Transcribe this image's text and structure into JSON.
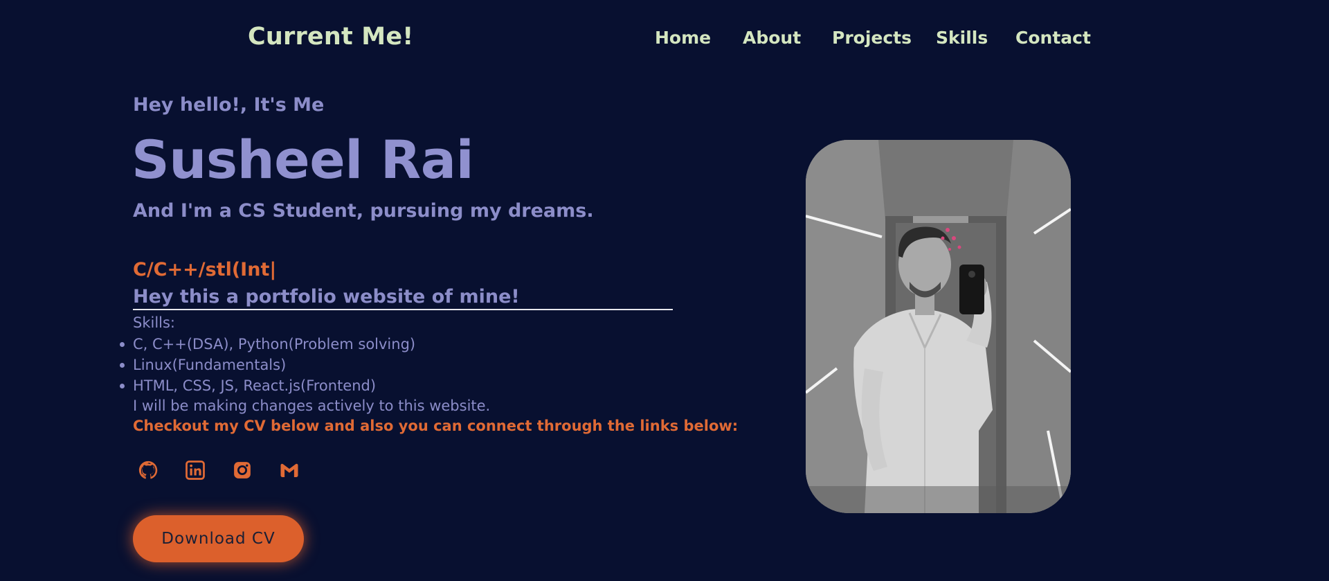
{
  "header": {
    "brand": "Current Me!",
    "nav": [
      "Home",
      "About",
      "Projects",
      "Skills",
      "Contact"
    ]
  },
  "hero": {
    "greeting": "Hey hello!, It's Me",
    "name": "Susheel Rai",
    "tagline": "And I'm a CS Student, pursuing my dreams.",
    "typed_text": "C/C++/stl(Int|",
    "portfolio_line": "Hey this a portfolio website of mine!",
    "skills_title": "Skills:",
    "skills": [
      "C, C++(DSA), Python(Problem solving)",
      "Linux(Fundamentals)",
      "HTML, CSS, JS, React.js(Frontend)"
    ],
    "note": "I will be making changes actively to this website.",
    "checkout": "Checkout my CV below and also you can connect through the links below:",
    "cv_button": "Download CV"
  },
  "social_icons": [
    "github-icon",
    "linkedin-icon",
    "instagram-icon",
    "gmail-icon"
  ],
  "colors": {
    "background": "#081030",
    "nav_text": "#d4e6c0",
    "body_text": "#8c8dc9",
    "accent": "#e06a35"
  }
}
